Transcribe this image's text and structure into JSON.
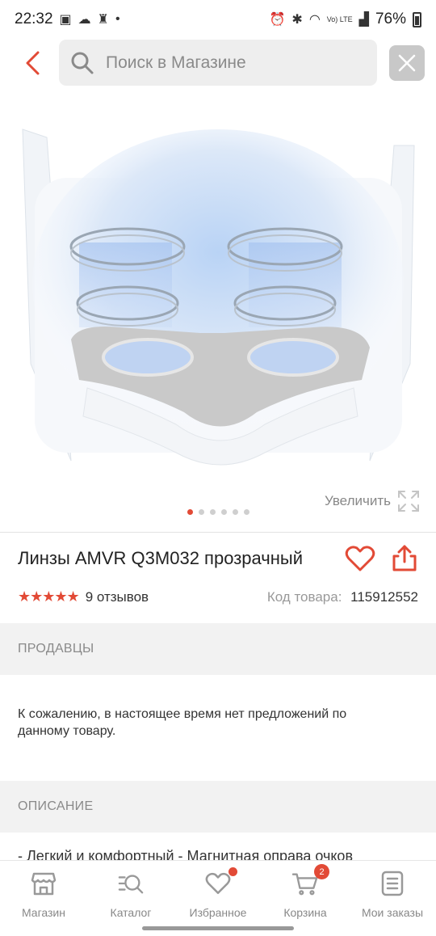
{
  "status_bar": {
    "time": "22:32",
    "battery": "76%",
    "network": "Vo) LTE"
  },
  "search": {
    "placeholder": "Поиск в Магазине"
  },
  "gallery": {
    "zoom_label": "Увеличить",
    "image_count": 6,
    "active_index": 0
  },
  "product": {
    "title": "Линзы AMVR Q3M032 прозрачный",
    "rating": 4.5,
    "stars": "★★★★★",
    "reviews": "9 отзывов",
    "code_label": "Код товара:",
    "code_value": "115912552"
  },
  "sellers": {
    "heading": "ПРОДАВЦЫ",
    "text": "К сожалению, в настоящее время нет предложений по данному товару."
  },
  "description": {
    "heading": "ОПИСАНИЕ",
    "text": "- Легкий и комфортный - Магнитная оправа очков"
  },
  "nav": {
    "items": [
      {
        "label": "Магазин",
        "icon": "store-icon"
      },
      {
        "label": "Каталог",
        "icon": "catalog-search-icon"
      },
      {
        "label": "Избранное",
        "icon": "heart-icon"
      },
      {
        "label": "Корзина",
        "icon": "cart-icon",
        "badge": "2"
      },
      {
        "label": "Мои заказы",
        "icon": "orders-icon"
      }
    ]
  },
  "colors": {
    "accent": "#e24a36",
    "section_bg": "#f2f2f2"
  }
}
